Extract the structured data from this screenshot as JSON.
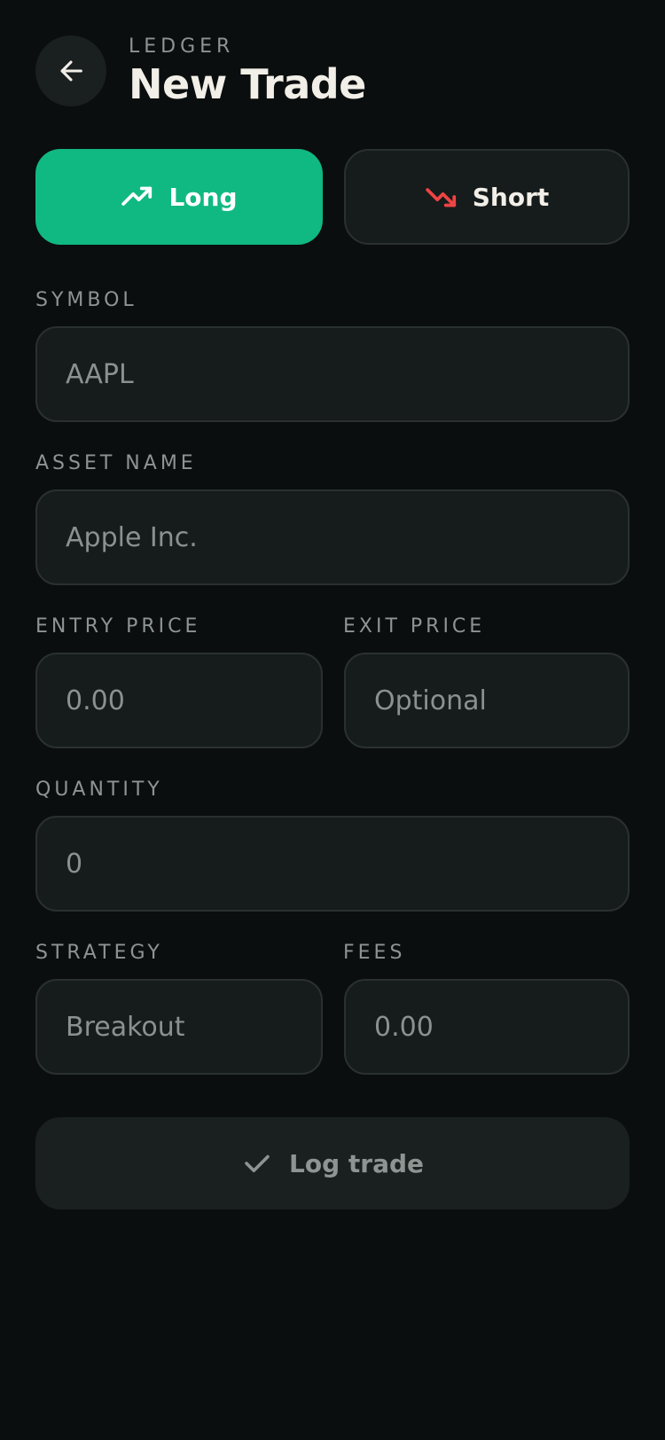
{
  "header": {
    "eyebrow": "LEDGER",
    "title": "New Trade",
    "back_icon": "arrow-left-icon"
  },
  "direction": {
    "long_label": "Long",
    "short_label": "Short",
    "selected": "Long",
    "long_icon": "trending-up-icon",
    "short_icon": "trending-down-icon"
  },
  "form": {
    "symbol": {
      "label": "SYMBOL",
      "placeholder": "AAPL",
      "value": ""
    },
    "asset_name": {
      "label": "ASSET NAME",
      "placeholder": "Apple Inc.",
      "value": ""
    },
    "entry_price": {
      "label": "ENTRY PRICE",
      "placeholder": "0.00",
      "value": ""
    },
    "exit_price": {
      "label": "EXIT PRICE",
      "placeholder": "Optional",
      "value": ""
    },
    "quantity": {
      "label": "QUANTITY",
      "placeholder": "0",
      "value": ""
    },
    "strategy": {
      "label": "STRATEGY",
      "placeholder": "Breakout",
      "value": ""
    },
    "fees": {
      "label": "FEES",
      "placeholder": "0.00",
      "value": ""
    }
  },
  "submit": {
    "label": "Log trade",
    "icon": "check-icon"
  },
  "colors": {
    "background": "#0b0e0e",
    "surface": "#161b1b",
    "accent_long": "#10b981",
    "accent_short": "#ef4444",
    "text_primary": "#f2efe8",
    "text_muted": "#8d9491"
  }
}
